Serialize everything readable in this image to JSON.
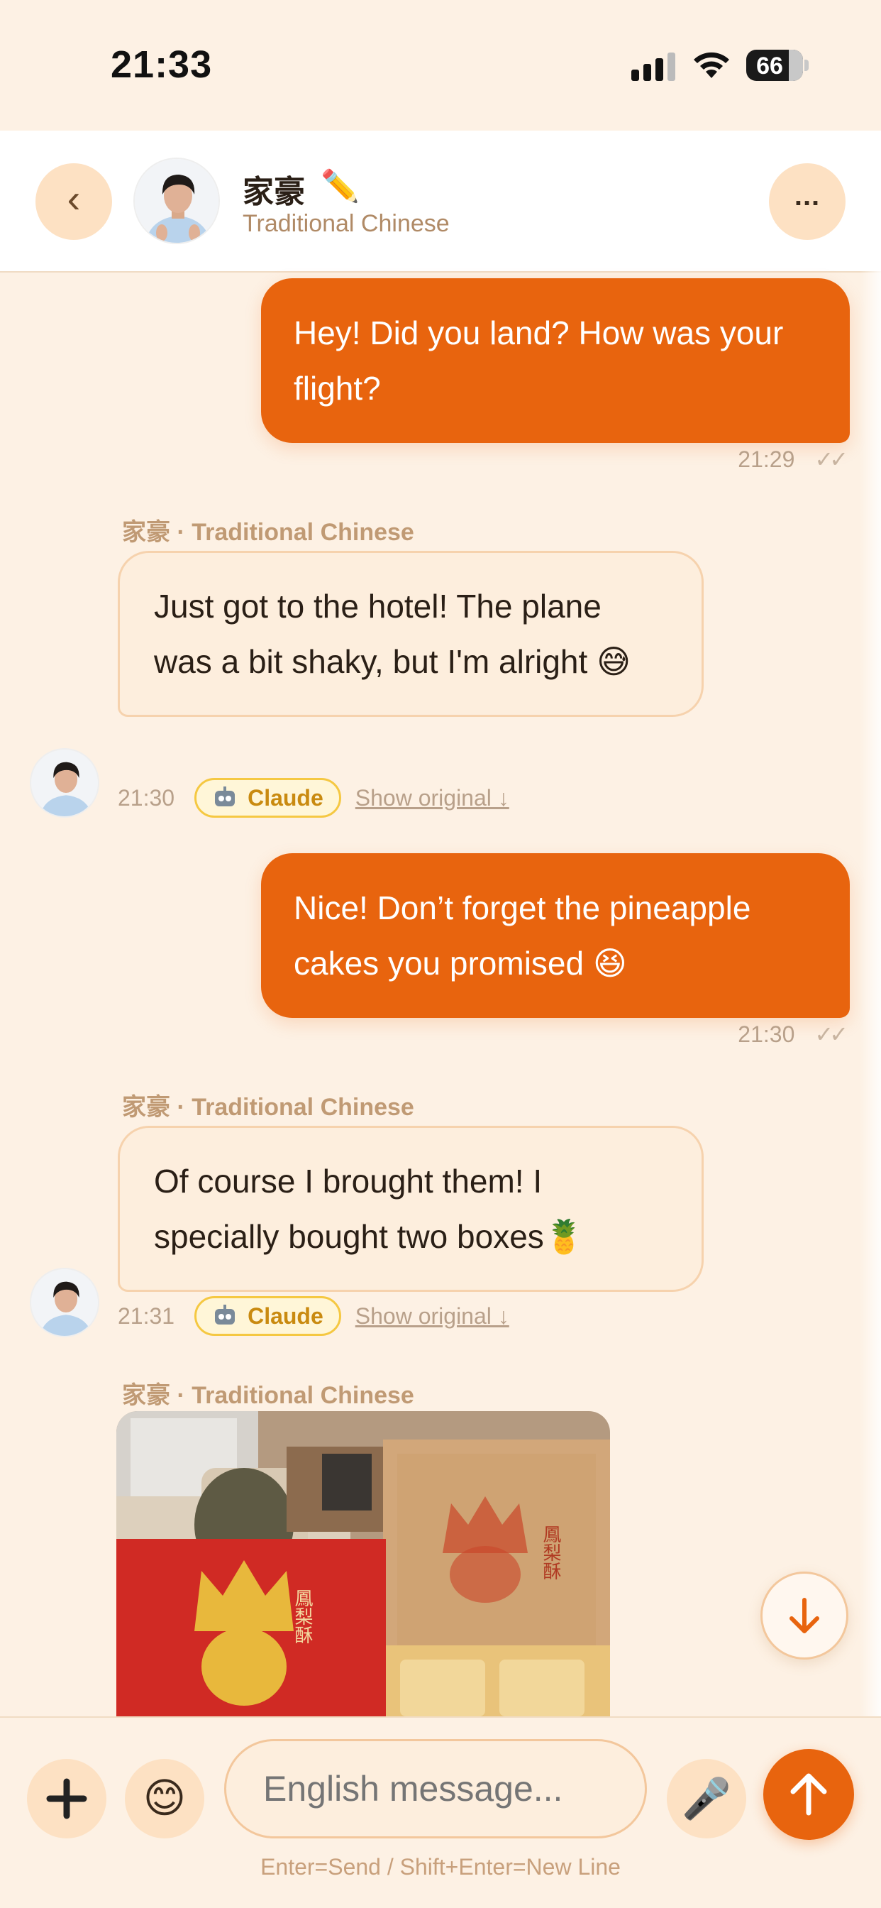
{
  "status_bar": {
    "time": "21:33",
    "battery": "66"
  },
  "header": {
    "back_glyph": "‹",
    "contact_name": "家豪",
    "name_emoji": "✏️",
    "language": "Traditional Chinese",
    "more_glyph": "..."
  },
  "messages": [
    {
      "direction": "out",
      "text": "Hey! Did you land? How was your flight?",
      "time": "21:29",
      "ticks": "✓✓"
    },
    {
      "direction": "in",
      "sender": "家豪 · Traditional Chinese",
      "text": "Just got to the hotel! The plane was a bit shaky, but I'm alright 😅",
      "time": "21:30",
      "badge": "Claude",
      "show_original": "Show original ↓"
    },
    {
      "direction": "out",
      "text": "Nice! Don’t forget the pineapple cakes you promised 😆",
      "time": "21:30",
      "ticks": "✓✓"
    },
    {
      "direction": "in",
      "sender": "家豪 · Traditional Chinese",
      "text": "Of course I brought them! I specially bought two boxes🍍",
      "time": "21:31",
      "badge": "Claude",
      "show_original": "Show original ↓"
    },
    {
      "direction": "in",
      "sender": "家豪 · Traditional Chinese",
      "type": "image"
    }
  ],
  "photo": {
    "box_text_left": "鳳梨酥",
    "box_text_right": "鳳梨酥"
  },
  "composer": {
    "emoji": "😊",
    "placeholder": "English message...",
    "mic": "🎤",
    "hint": "Enter=Send / Shift+Enter=New Line"
  },
  "colors": {
    "accent": "#e8640e",
    "background": "#fdf1e4",
    "bubble_in": "#fdeedd",
    "badge_border": "#f5c842"
  },
  "icons": [
    "signal-icon",
    "wifi-icon",
    "battery-icon",
    "back-icon",
    "more-icon",
    "robot-icon",
    "arrow-down-icon",
    "plus-icon",
    "smile-icon",
    "mic-icon",
    "send-arrow-icon"
  ]
}
